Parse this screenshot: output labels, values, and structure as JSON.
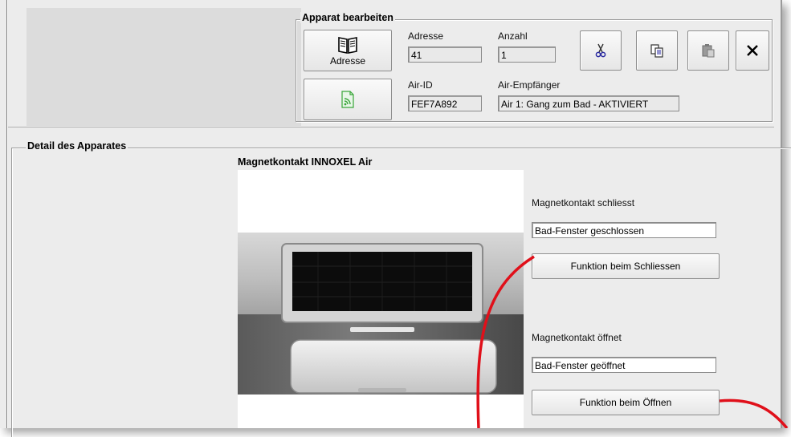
{
  "group_edit": {
    "title": "Apparat bearbeiten",
    "address_button_label": "Adresse",
    "address_label": "Adresse",
    "address_value": "41",
    "count_label": "Anzahl",
    "count_value": "1",
    "air_id_label": "Air-ID",
    "air_id_value": "FEF7A892",
    "receiver_label": "Air-Empfänger",
    "receiver_value": "Air 1: Gang zum Bad - AKTIVIERT"
  },
  "toolbar_icons": [
    "scissors-icon",
    "copy-icon",
    "paste-icon",
    "close-icon",
    "book-icon",
    "rss-icon"
  ],
  "detail": {
    "title": "Detail des Apparates",
    "device_name": "Magnetkontakt INNOXEL Air",
    "close_label": "Magnetkontakt schliesst",
    "close_value": "Bad-Fenster geschlossen",
    "close_button": "Funktion beim Schliessen",
    "open_label": "Magnetkontakt öffnet",
    "open_value": "Bad-Fenster geöffnet",
    "open_button": "Funktion beim Öffnen"
  },
  "colors": {
    "annotation": "#e0101a",
    "rss": "#3aa63a",
    "window_bg": "#ececec"
  }
}
